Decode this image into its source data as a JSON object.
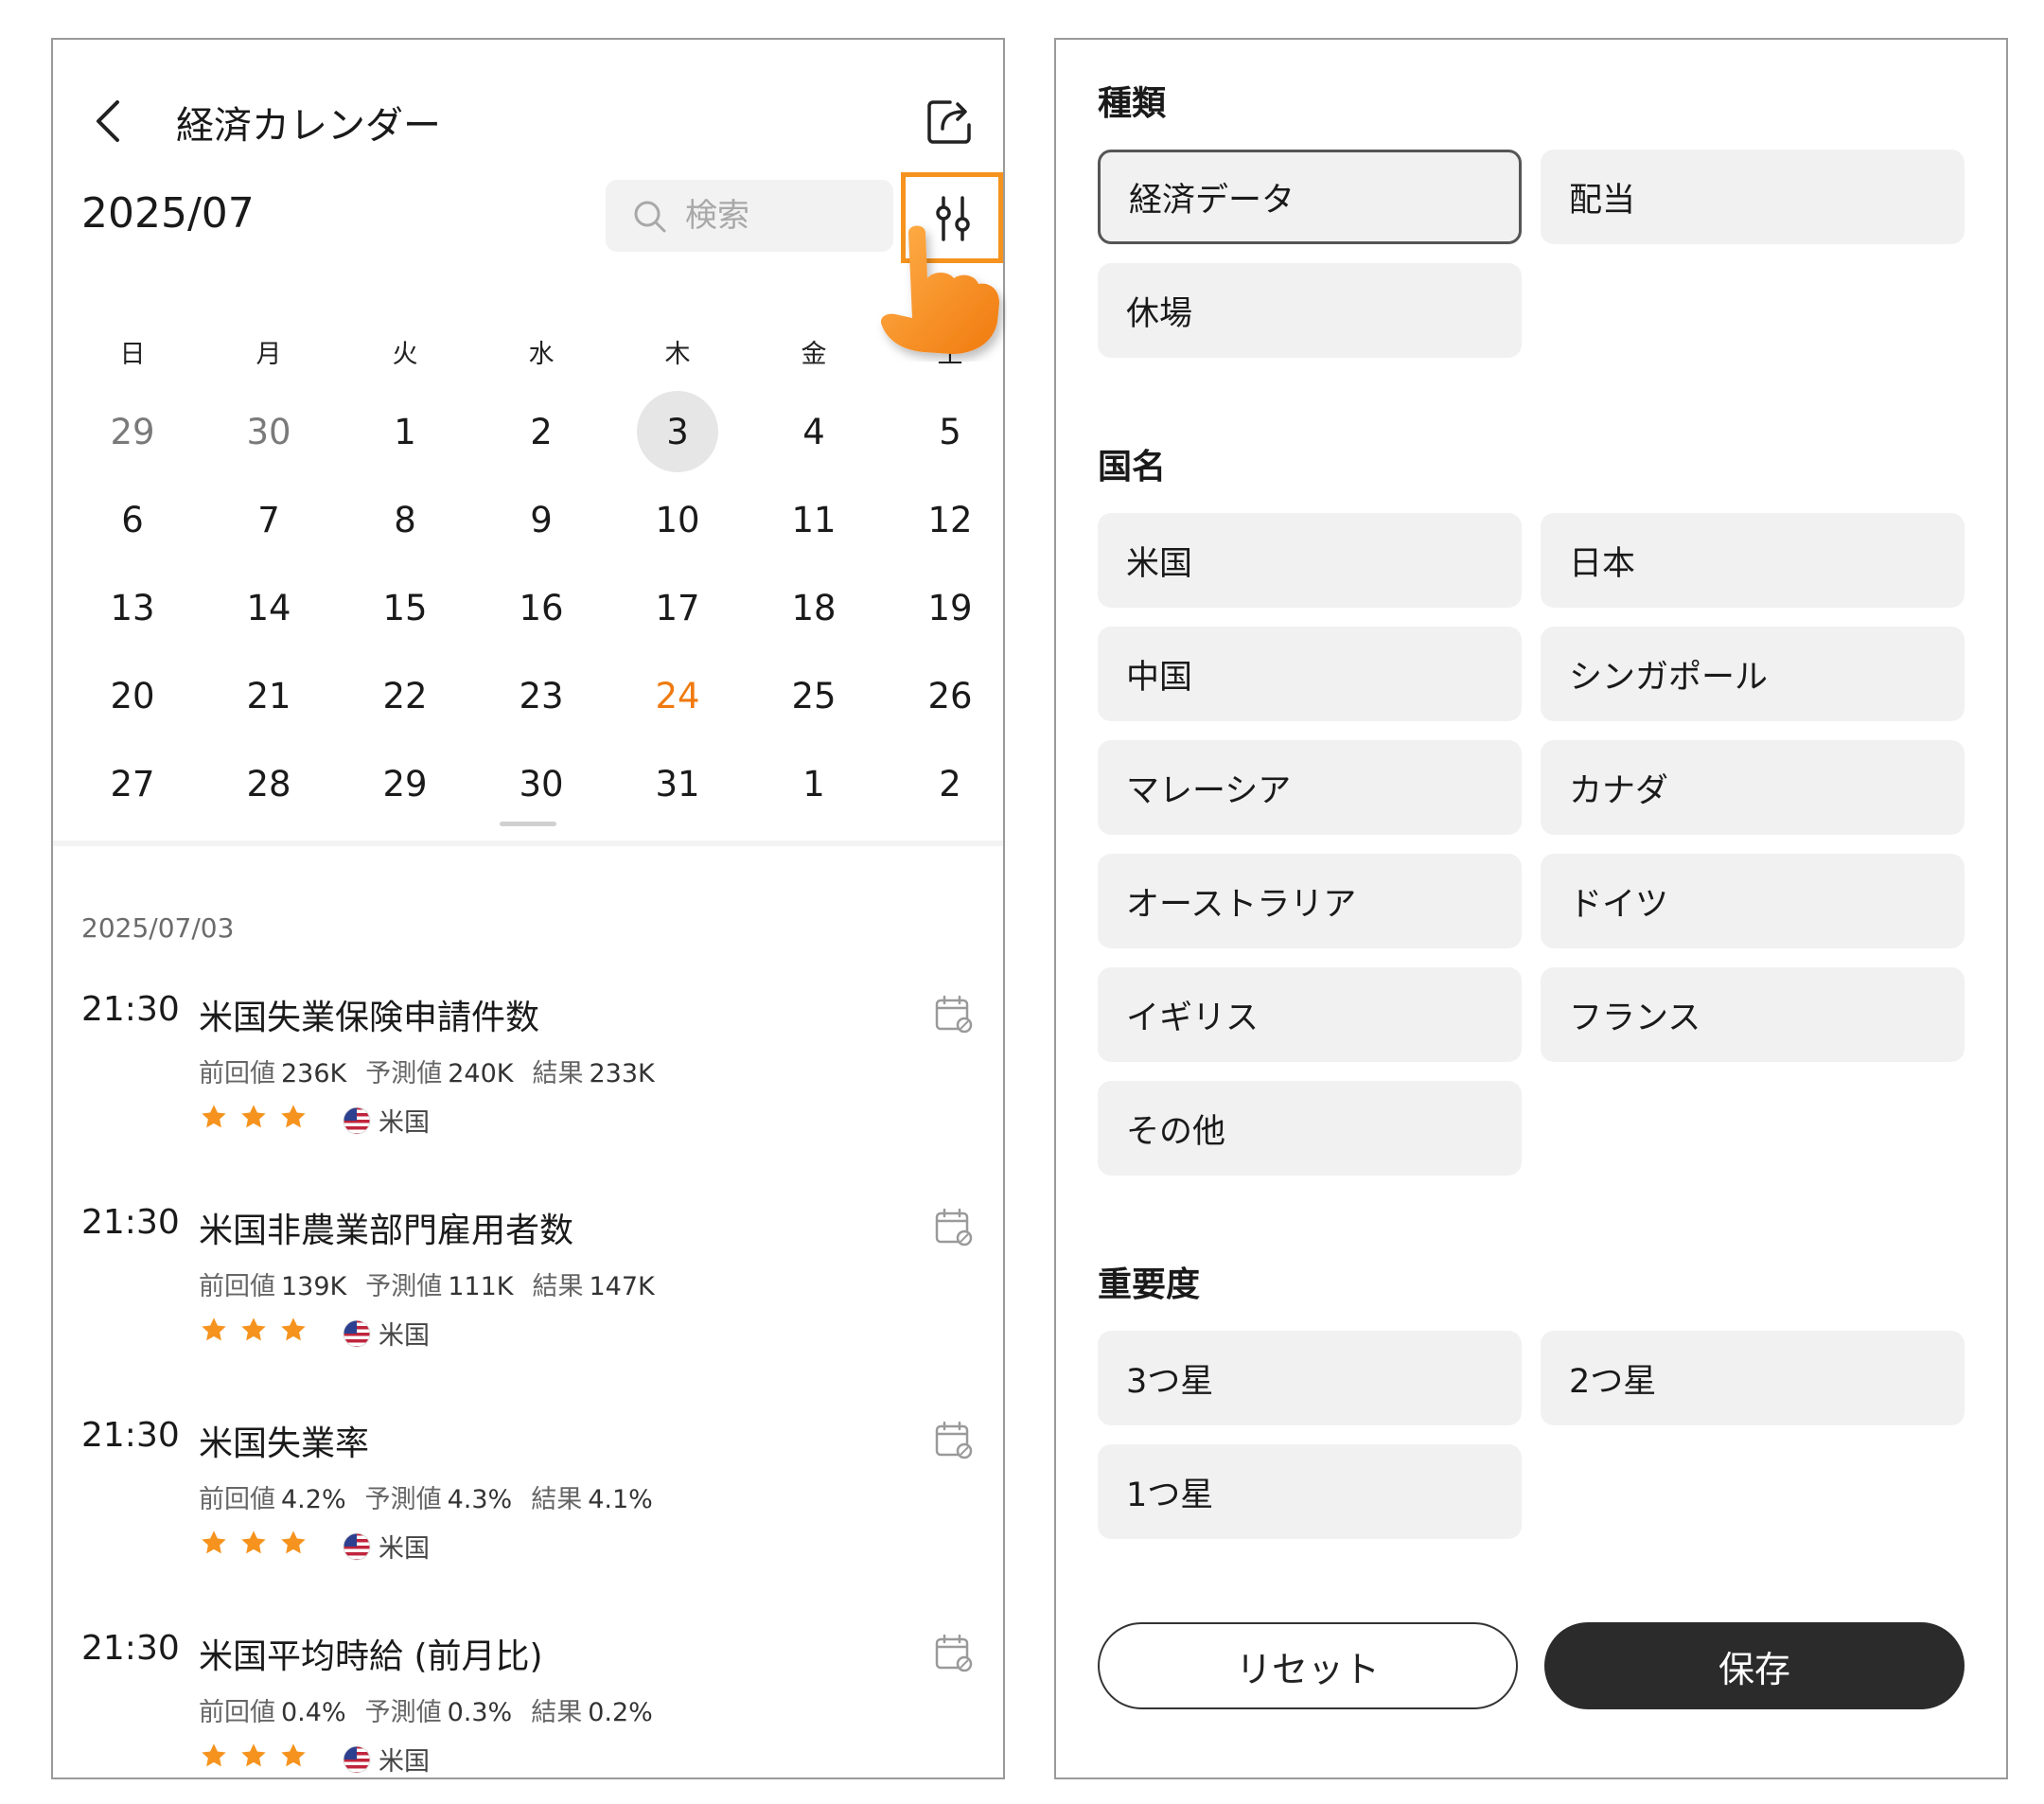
{
  "header": {
    "title": "経済カレンダー",
    "month": "2025/07",
    "search_placeholder": "検索"
  },
  "calendar": {
    "weekdays": [
      "日",
      "月",
      "火",
      "水",
      "木",
      "金",
      "土"
    ],
    "weeks": [
      [
        {
          "d": "29",
          "muted": true
        },
        {
          "d": "30",
          "muted": true
        },
        {
          "d": "1"
        },
        {
          "d": "2"
        },
        {
          "d": "3",
          "selected": true
        },
        {
          "d": "4"
        },
        {
          "d": "5"
        }
      ],
      [
        {
          "d": "6"
        },
        {
          "d": "7"
        },
        {
          "d": "8"
        },
        {
          "d": "9"
        },
        {
          "d": "10"
        },
        {
          "d": "11"
        },
        {
          "d": "12"
        }
      ],
      [
        {
          "d": "13"
        },
        {
          "d": "14"
        },
        {
          "d": "15"
        },
        {
          "d": "16"
        },
        {
          "d": "17"
        },
        {
          "d": "18"
        },
        {
          "d": "19"
        }
      ],
      [
        {
          "d": "20"
        },
        {
          "d": "21"
        },
        {
          "d": "22"
        },
        {
          "d": "23"
        },
        {
          "d": "24",
          "today": true
        },
        {
          "d": "25"
        },
        {
          "d": "26"
        }
      ],
      [
        {
          "d": "27"
        },
        {
          "d": "28"
        },
        {
          "d": "29"
        },
        {
          "d": "30"
        },
        {
          "d": "31"
        },
        {
          "d": "1"
        },
        {
          "d": "2"
        }
      ]
    ],
    "today_color": "#f07a0f"
  },
  "events": {
    "date": "2025/07/03",
    "labels": {
      "prev": "前回値",
      "forecast": "予測値",
      "result": "結果"
    },
    "items": [
      {
        "time": "21:30",
        "title": "米国失業保険申請件数",
        "prev": "236K",
        "forecast": "240K",
        "result": "233K",
        "stars": 3,
        "country": "米国"
      },
      {
        "time": "21:30",
        "title": "米国非農業部門雇用者数",
        "prev": "139K",
        "forecast": "111K",
        "result": "147K",
        "stars": 3,
        "country": "米国"
      },
      {
        "time": "21:30",
        "title": "米国失業率",
        "prev": "4.2%",
        "forecast": "4.3%",
        "result": "4.1%",
        "stars": 3,
        "country": "米国"
      },
      {
        "time": "21:30",
        "title": "米国平均時給 (前月比)",
        "prev": "0.4%",
        "forecast": "0.3%",
        "result": "0.2%",
        "stars": 3,
        "country": "米国"
      }
    ]
  },
  "filter": {
    "type_title": "種類",
    "types": [
      "経済データ",
      "配当",
      "休場"
    ],
    "type_selected": "経済データ",
    "country_title": "国名",
    "countries": [
      "米国",
      "日本",
      "中国",
      "シンガポール",
      "マレーシア",
      "カナダ",
      "オーストラリア",
      "ドイツ",
      "イギリス",
      "フランス",
      "その他"
    ],
    "importance_title": "重要度",
    "importance": [
      "3つ星",
      "2つ星",
      "1つ星"
    ],
    "reset_label": "リセット",
    "save_label": "保存"
  },
  "colors": {
    "accent": "#f5931e",
    "star": "#f5931e",
    "save_bg": "#2b2b2b"
  },
  "icons": [
    "back-icon",
    "share-icon",
    "search-icon",
    "filter-icon",
    "hand-pointer-icon",
    "calendar-add-icon",
    "star-icon",
    "us-flag-icon"
  ]
}
